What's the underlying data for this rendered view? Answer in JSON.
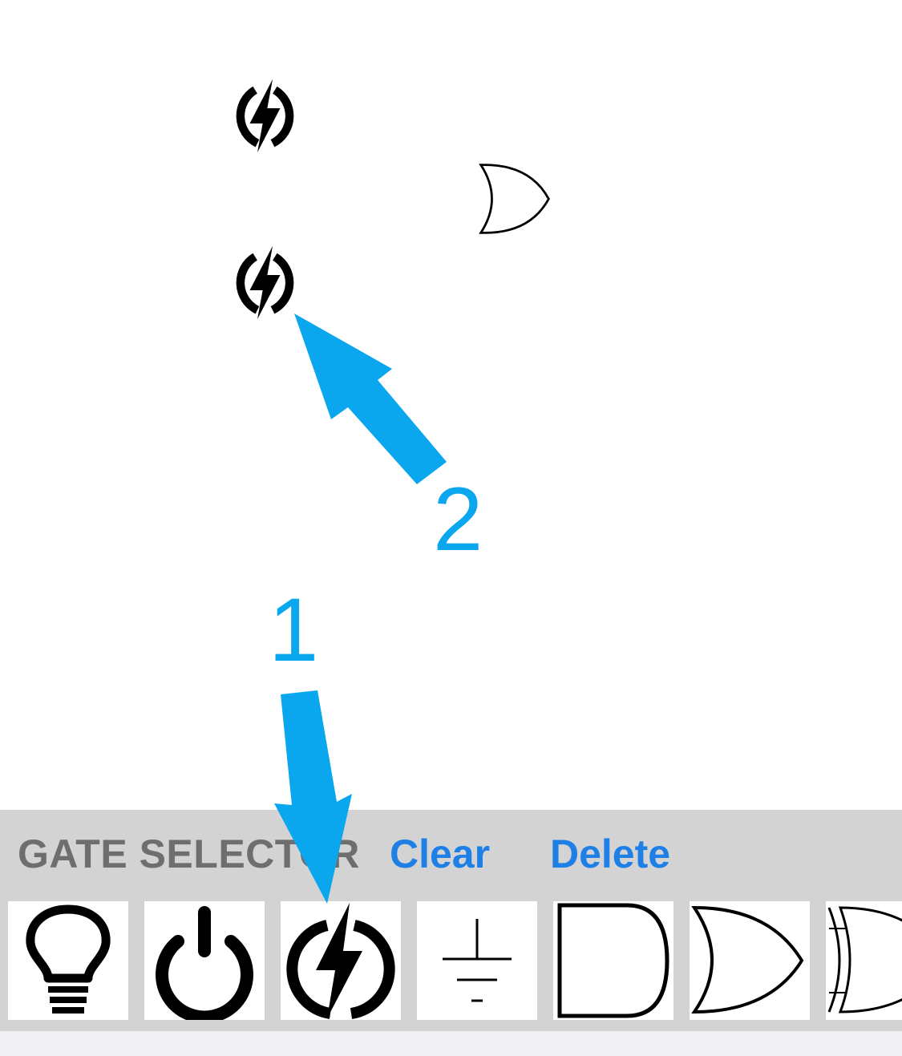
{
  "canvas": {
    "placed": [
      {
        "type": "power-source",
        "icon": "lightning-bolt-icon"
      },
      {
        "type": "or-gate",
        "icon": "or-gate-icon"
      },
      {
        "type": "power-source",
        "icon": "lightning-bolt-icon"
      }
    ]
  },
  "gate_selector": {
    "title": "GATE SELECTOR",
    "clear_label": "Clear",
    "delete_label": "Delete",
    "items": [
      {
        "name": "light-bulb",
        "icon": "lightbulb-icon"
      },
      {
        "name": "switch",
        "icon": "power-icon"
      },
      {
        "name": "power-source",
        "icon": "lightning-bolt-icon"
      },
      {
        "name": "ground",
        "icon": "ground-icon"
      },
      {
        "name": "and-gate",
        "icon": "and-gate-icon"
      },
      {
        "name": "or-gate",
        "icon": "or-gate-icon"
      },
      {
        "name": "xor-gate",
        "icon": "xor-gate-icon"
      }
    ]
  },
  "annotations": {
    "arrow_1_label": "1",
    "arrow_2_label": "2",
    "color": "#0aa7ef"
  },
  "colors": {
    "panel_bg": "#d3d3d3",
    "title_text": "#6e6e6e",
    "button_text": "#1e7fe6",
    "bottom_bar": "#efeff4"
  }
}
